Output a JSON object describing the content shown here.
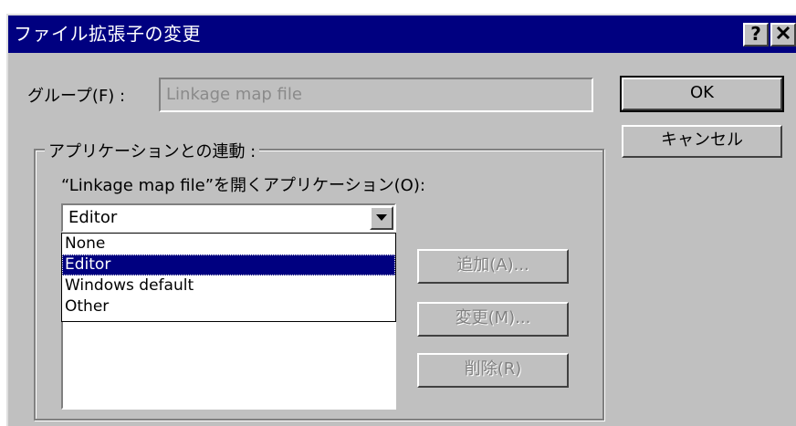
{
  "dialog": {
    "title": "ファイル拡張子の変更",
    "help_button": "?",
    "close_button": "×"
  },
  "group_field": {
    "label": "グループ(F) :",
    "value": "Linkage map file"
  },
  "buttons": {
    "ok": "OK",
    "cancel": "キャンセル",
    "add": "追加(A)...",
    "change": "変更(M)...",
    "delete": "削除(R)"
  },
  "app_link_group": {
    "title": "アプリケーションとの連動 :",
    "open_with_label": "“Linkage map file”を開くアプリケーション(O):",
    "combo": {
      "selected": "Editor",
      "options": [
        "None",
        "Editor",
        "Windows default",
        "Other"
      ],
      "highlighted_index": 1
    }
  },
  "colors": {
    "titlebar": "#000080",
    "face": "#c0c0c0",
    "selection": "#000080"
  }
}
